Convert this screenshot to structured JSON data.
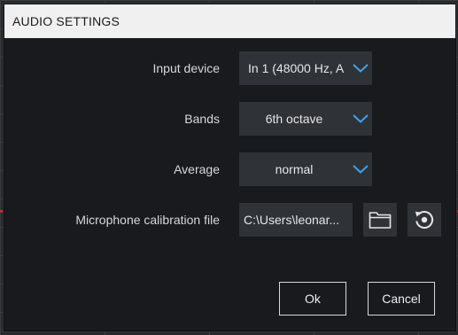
{
  "dialog": {
    "title": "AUDIO SETTINGS"
  },
  "fields": {
    "input_device": {
      "label": "Input device",
      "value": "In 1 (48000 Hz, A"
    },
    "bands": {
      "label": "Bands",
      "value": "6th octave"
    },
    "average": {
      "label": "Average",
      "value": "normal"
    },
    "calibration": {
      "label": "Microphone calibration file",
      "value": "C:\\Users\\leonar..."
    }
  },
  "buttons": {
    "ok_label": "Ok",
    "cancel_label": "Cancel"
  },
  "icons": {
    "dropdown": "chevron-down-icon",
    "browse": "folder-icon",
    "reset": "reset-icon"
  },
  "colors": {
    "accent": "#3ea3ef",
    "dialog_bg": "#181a1d",
    "control_bg": "#2f3236",
    "titlebar_bg": "#f0f0f0"
  }
}
